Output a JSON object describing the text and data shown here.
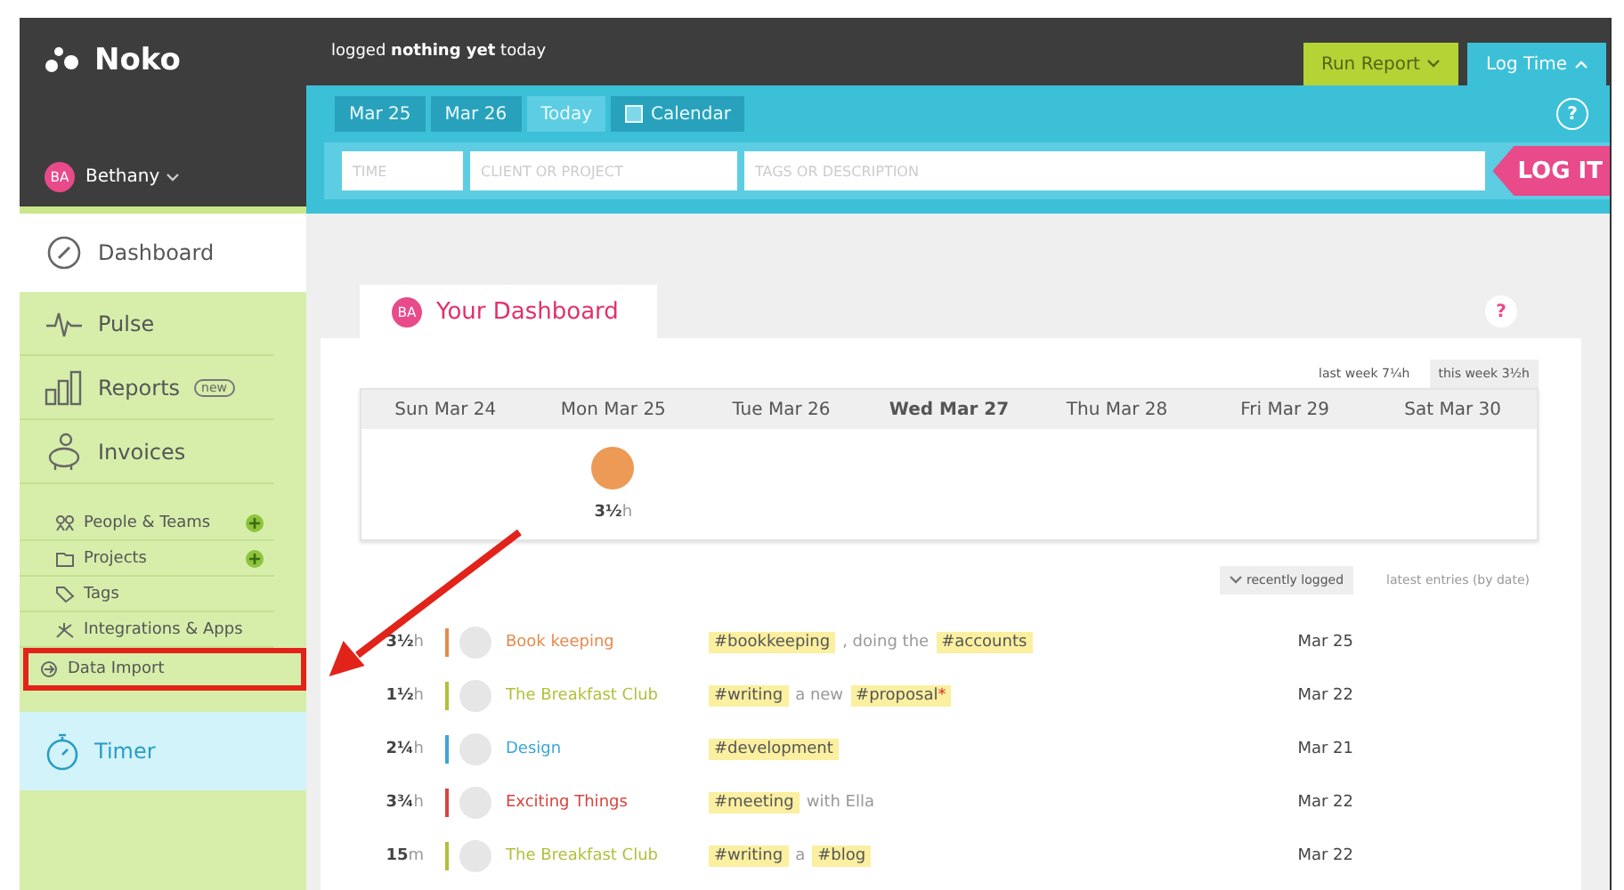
{
  "brand": {
    "name": "Noko"
  },
  "status": "logged **nothing yet** today",
  "user": {
    "initials": "BA",
    "name": "Bethany"
  },
  "header_buttons": [
    {
      "label": "Run Report",
      "kind": "report"
    },
    {
      "label": "Log Time",
      "kind": "log"
    }
  ],
  "date_tabs": [
    {
      "label": "Mar 25",
      "selected": false,
      "kind": "date"
    },
    {
      "label": "Mar 26",
      "selected": false,
      "kind": "date"
    },
    {
      "label": "Today",
      "selected": true,
      "kind": "date"
    },
    {
      "label": "Calendar",
      "selected": false,
      "kind": "calendar"
    }
  ],
  "entry_fields": [
    {
      "placeholder": "TIME"
    },
    {
      "placeholder": "CLIENT OR PROJECT"
    },
    {
      "placeholder": "TAGS OR DESCRIPTION"
    }
  ],
  "log_button": "LOG IT",
  "entry_help": "?",
  "nav": [
    {
      "label": "Dashboard",
      "selected": true
    },
    {
      "label": "Pulse",
      "selected": false
    },
    {
      "label": "Reports",
      "selected": false,
      "badge": "new"
    },
    {
      "label": "Invoices",
      "selected": false
    }
  ],
  "sub_nav": [
    {
      "label": "People & Teams",
      "addable": true,
      "highlighted": false
    },
    {
      "label": "Projects",
      "addable": true,
      "highlighted": false
    },
    {
      "label": "Tags",
      "addable": false,
      "highlighted": false
    },
    {
      "label": "Integrations & Apps",
      "addable": false,
      "highlighted": false
    },
    {
      "label": "Data Import",
      "addable": false,
      "highlighted": true
    }
  ],
  "timer": {
    "label": "Timer"
  },
  "dashboard": {
    "initials": "BA",
    "title": "Your Dashboard",
    "help": "?",
    "week_toggle": [
      {
        "label": "last week 7¼h",
        "selected": false
      },
      {
        "label": "this week 3½h",
        "selected": true
      }
    ],
    "days": [
      {
        "label": "Sun Mar 24",
        "today": false
      },
      {
        "label": "Mon Mar 25",
        "today": false,
        "amount": "3½",
        "unit": "h",
        "color": "#ec9a55"
      },
      {
        "label": "Tue Mar 26",
        "today": false
      },
      {
        "label": "Wed Mar 27",
        "today": true
      },
      {
        "label": "Thu Mar 28",
        "today": false
      },
      {
        "label": "Fri Mar 29",
        "today": false
      },
      {
        "label": "Sat Mar 30",
        "today": false
      }
    ],
    "sort": [
      {
        "label": "recently logged",
        "selected": true
      },
      {
        "label": "latest entries (by date)",
        "selected": false
      }
    ],
    "entries": [
      {
        "amount": "3½",
        "unit": "h",
        "project": "Book keeping",
        "color": "#e58a4e",
        "description": [
          {
            "kind": "tag",
            "text": "#bookkeeping"
          },
          {
            "kind": "text",
            "text": ", doing the"
          },
          {
            "kind": "tag",
            "text": "#accounts"
          }
        ],
        "date": "Mar 25"
      },
      {
        "amount": "1½",
        "unit": "h",
        "project": "The Breakfast Club",
        "color": "#b2bf3a",
        "description": [
          {
            "kind": "tag",
            "text": "#writing"
          },
          {
            "kind": "text",
            "text": "a new"
          },
          {
            "kind": "tag",
            "text": "#proposal",
            "flag": "*"
          }
        ],
        "date": "Mar 22"
      },
      {
        "amount": "2¼",
        "unit": "h",
        "project": "Design",
        "color": "#3aa6d6",
        "description": [
          {
            "kind": "tag",
            "text": "#development"
          }
        ],
        "date": "Mar 21"
      },
      {
        "amount": "3¾",
        "unit": "h",
        "project": "Exciting Things",
        "color": "#d8443e",
        "description": [
          {
            "kind": "tag",
            "text": "#meeting"
          },
          {
            "kind": "text",
            "text": "with Ella"
          }
        ],
        "date": "Mar 22"
      },
      {
        "amount": "15",
        "unit": "m",
        "project": "The Breakfast Club",
        "color": "#b2bf3a",
        "description": [
          {
            "kind": "tag",
            "text": "#writing"
          },
          {
            "kind": "text",
            "text": "a"
          },
          {
            "kind": "tag",
            "text": "#blog"
          }
        ],
        "date": "Mar 22"
      }
    ]
  }
}
